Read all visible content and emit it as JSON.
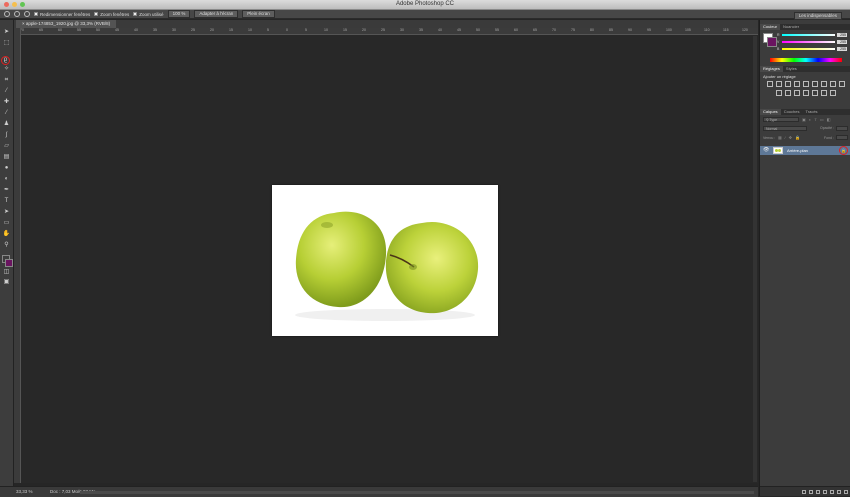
{
  "app": {
    "title": "Adobe Photoshop CC"
  },
  "options_bar": {
    "resize_windows_label": "Redimensionner fenêtres",
    "zoom_all_windows_label": "Zoom fenêtres",
    "scrubby_zoom_label": "Zoom utilisé",
    "zoom_value": "100 %",
    "fit_screen_label": "Adapter à l'écran",
    "fill_screen_label": "Plein écran",
    "workspace_label": "Les indispensables"
  },
  "document": {
    "tab_label": "apple-174853_1920.jpg @ 33,3% (RVB/8)",
    "zoom": "33,33 %",
    "doc_info": "Doc : 7,03 Mo/6,03 Mo"
  },
  "ruler_marks": [
    "70",
    "65",
    "60",
    "55",
    "50",
    "45",
    "40",
    "35",
    "30",
    "25",
    "20",
    "15",
    "10",
    "5",
    "0",
    "5",
    "10",
    "15",
    "20",
    "25",
    "30",
    "35",
    "40",
    "45",
    "50",
    "55",
    "60",
    "65",
    "70",
    "75",
    "80",
    "85",
    "90",
    "95",
    "100",
    "105",
    "110",
    "115",
    "120"
  ],
  "color_panel": {
    "tabs": [
      "Couleur",
      "Nuancier"
    ],
    "r_value": "255",
    "g_value": "255",
    "b_value": "255",
    "colors": {
      "fg": "#ffffff",
      "bg": "#6a1460"
    }
  },
  "adjustments_panel": {
    "tabs": [
      "Réglages",
      "Styles"
    ],
    "heading": "Ajouter un réglage"
  },
  "layers_panel": {
    "tabs": [
      "Calques",
      "Couches",
      "Tracés"
    ],
    "filter_label": "Type",
    "blend_mode": "Normal",
    "opacity_label": "Opacité :",
    "lock_label": "Verrou :",
    "fill_label": "Fond :",
    "layer_name": "Arrière-plan"
  },
  "colors": {
    "accent_red": "#e02020",
    "layer_selected": "#5e7897"
  }
}
